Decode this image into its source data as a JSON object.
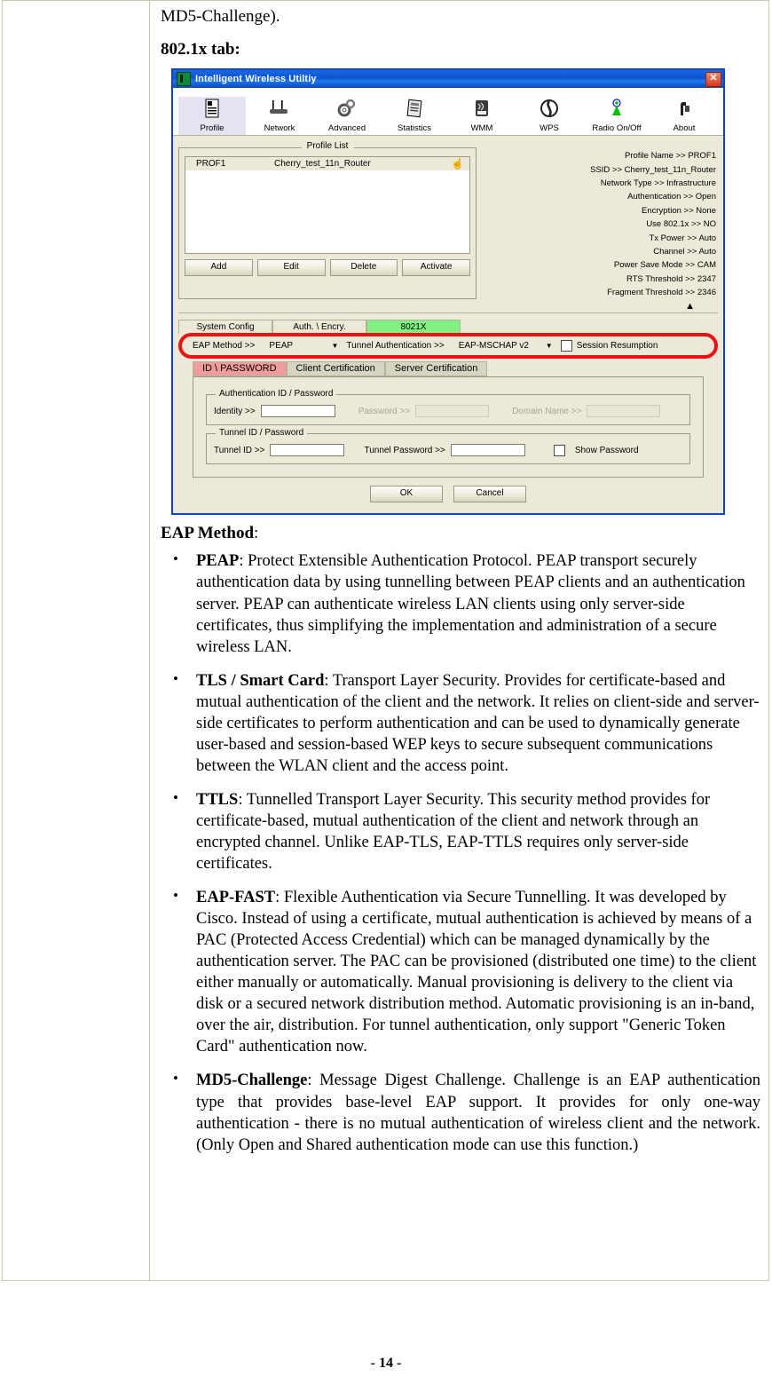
{
  "document": {
    "top_text": "MD5-Challenge).",
    "section_heading": "802.1x tab:",
    "page_number": "- 14 -"
  },
  "app_window": {
    "title": "Intelligent Wireless Utiltiy",
    "title_icon": "wireless-utility-icon",
    "close_label": "✕",
    "toolbar": [
      {
        "label": "Profile",
        "icon": "profile-icon",
        "glyph": "☰",
        "active": true
      },
      {
        "label": "Network",
        "icon": "network-icon",
        "glyph": "┳",
        "active": false
      },
      {
        "label": "Advanced",
        "icon": "advanced-icon",
        "glyph": "⚙",
        "active": false
      },
      {
        "label": "Statistics",
        "icon": "statistics-icon",
        "glyph": "▦",
        "active": false
      },
      {
        "label": "WMM",
        "icon": "wmm-icon",
        "glyph": "▤",
        "active": false
      },
      {
        "label": "WPS",
        "icon": "wps-icon",
        "glyph": "⬤",
        "active": false
      },
      {
        "label": "Radio On/Off",
        "icon": "radio-onoff-icon",
        "glyph": "⚡",
        "active": false
      },
      {
        "label": "About",
        "icon": "about-icon",
        "glyph": "ℹ",
        "active": false
      }
    ],
    "profile_list": {
      "group_title": "Profile List",
      "rows": [
        {
          "name": "PROF1",
          "ssid": "Cherry_test_11n_Router",
          "indicator_icon": "hand-pointer-icon"
        }
      ],
      "buttons": [
        "Add",
        "Edit",
        "Delete",
        "Activate"
      ]
    },
    "profile_detail": [
      {
        "label": "Profile Name >>",
        "value": "PROF1"
      },
      {
        "label": "SSID >>",
        "value": "Cherry_test_11n_Router"
      },
      {
        "label": "Network Type >>",
        "value": "Infrastructure"
      },
      {
        "label": "Authentication >>",
        "value": "Open"
      },
      {
        "label": "Encryption >>",
        "value": "None"
      },
      {
        "label": "Use 802.1x >>",
        "value": "NO"
      },
      {
        "label": "Tx Power >>",
        "value": "Auto"
      },
      {
        "label": "Channel >>",
        "value": "Auto"
      },
      {
        "label": "Power Save Mode >>",
        "value": "CAM"
      },
      {
        "label": "RTS Threshold >>",
        "value": "2347"
      },
      {
        "label": "Fragment Threshold >>",
        "value": "2346"
      }
    ],
    "collapse_arrow_icon": "collapse-up-arrow-icon",
    "config_tabs": [
      {
        "label": "System Config",
        "selected": false
      },
      {
        "label": "Auth. \\ Encry.",
        "selected": false
      },
      {
        "label": "8021X",
        "selected": true
      }
    ],
    "eap_row": {
      "eap_method_label": "EAP Method >>",
      "eap_method_value": "PEAP",
      "tunnel_auth_label": "Tunnel Authentication >>",
      "tunnel_auth_value": "EAP-MSCHAP v2",
      "session_resumption_label": "Session Resumption",
      "session_resumption_checked": false,
      "highlight_color": "#ee1111",
      "dropdown_icon": "chevron-down-icon"
    },
    "sub_tabs": [
      {
        "label": "ID \\ PASSWORD",
        "selected": true
      },
      {
        "label": "Client Certification",
        "selected": false
      },
      {
        "label": "Server Certification",
        "selected": false
      }
    ],
    "auth_group": {
      "title": "Authentication ID / Password",
      "identity_label": "Identity >>",
      "identity_value": "",
      "password_label": "Password >>",
      "password_value": "",
      "domain_label": "Domain Name >>",
      "domain_value": ""
    },
    "tunnel_group": {
      "title": "Tunnel ID / Password",
      "tunnel_id_label": "Tunnel ID >>",
      "tunnel_id_value": "",
      "tunnel_password_label": "Tunnel Password >>",
      "tunnel_password_value": "",
      "show_password_label": "Show Password",
      "show_password_checked": false
    },
    "dialog_buttons": {
      "ok": "OK",
      "cancel": "Cancel"
    }
  },
  "eap_section": {
    "heading_bold": "EAP Method",
    "heading_colon": ":",
    "items": [
      {
        "term": "PEAP",
        "text": ": Protect Extensible Authentication Protocol. PEAP transport securely authentication data by using tunnelling between PEAP clients and an authentication server. PEAP can authenticate wireless LAN clients using only server-side certificates, thus simplifying the implementation and administration of a secure wireless LAN.",
        "justified": false
      },
      {
        "term": "TLS / Smart Card",
        "text": ": Transport Layer Security. Provides for certificate-based and mutual authentication of the client and the network. It relies on client-side and server-side certificates to perform authentication and can be used to dynamically generate user-based and session-based WEP keys to secure subsequent communications between the WLAN client and the access point.",
        "justified": false
      },
      {
        "term": "TTLS",
        "text": ": Tunnelled Transport Layer Security. This security method provides for certificate-based, mutual authentication of the client and network through an encrypted channel. Unlike EAP-TLS, EAP-TTLS requires only server-side certificates.",
        "justified": false
      },
      {
        "term": "EAP-FAST",
        "text": ": Flexible Authentication via Secure Tunnelling. It was developed by Cisco. Instead of using a certificate, mutual authentication is achieved by means of a PAC (Protected Access Credential) which can be managed dynamically by the authentication server. The PAC can be provisioned (distributed one time) to the client either manually or automatically. Manual provisioning is delivery to the client via disk or a secured network distribution method. Automatic provisioning is an in-band, over the air, distribution. For tunnel authentication, only support \"Generic Token Card\" authentication now.",
        "justified": false
      },
      {
        "term": "MD5-Challenge",
        "text": ": Message Digest Challenge. Challenge is an EAP authentication type that provides base-level EAP support. It provides for only one-way authentication - there is no mutual authentication of wireless client and the network. (Only Open and Shared authentication mode can use this function.)",
        "justified": true
      }
    ]
  }
}
